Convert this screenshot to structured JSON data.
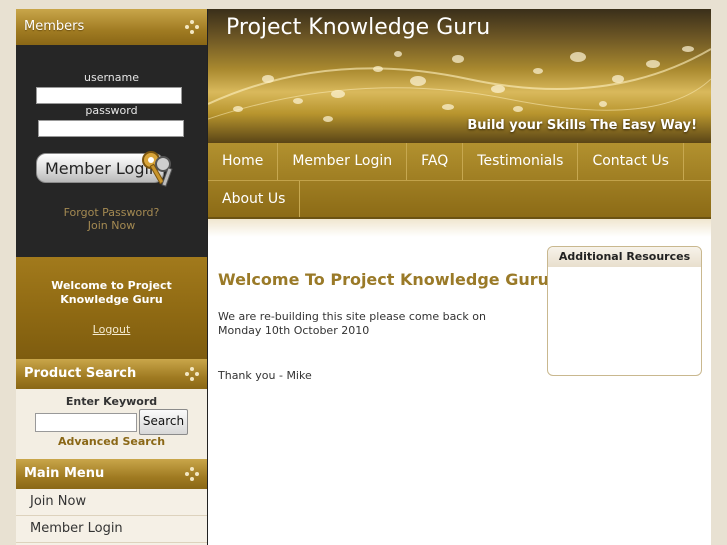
{
  "sidebar": {
    "members_header": "Members",
    "username_label": "username",
    "password_label": "password",
    "login_button": "Member Login",
    "forgot_password": "Forgot Password?",
    "join_now": "Join Now",
    "welcome_text": "Welcome to Project Knowledge Guru",
    "logout": "Logout",
    "product_search_header": "Product Search",
    "enter_keyword": "Enter Keyword",
    "search_button": "Search",
    "advanced_search": "Advanced Search",
    "main_menu_header": "Main Menu",
    "menu_items": [
      {
        "label": "Join Now"
      },
      {
        "label": "Member Login"
      }
    ]
  },
  "banner": {
    "title": "Project Knowledge Guru",
    "tagline": "Build your Skills The Easy Way!"
  },
  "nav": {
    "items": [
      {
        "label": "Home"
      },
      {
        "label": "Member Login"
      },
      {
        "label": "FAQ"
      },
      {
        "label": "Testimonials"
      },
      {
        "label": "Contact Us"
      },
      {
        "label": "About Us"
      }
    ]
  },
  "content": {
    "heading": "Welcome To Project Knowledge Guru",
    "paragraph1": "We are re-building this site please come back on Monday 10th October  2010",
    "paragraph2": "Thank you - Mike"
  },
  "resources": {
    "header": "Additional Resources"
  },
  "colors": {
    "accent_gold": "#9a7a28",
    "sidebar_dark": "#262626",
    "background": "#e8e1d2"
  }
}
